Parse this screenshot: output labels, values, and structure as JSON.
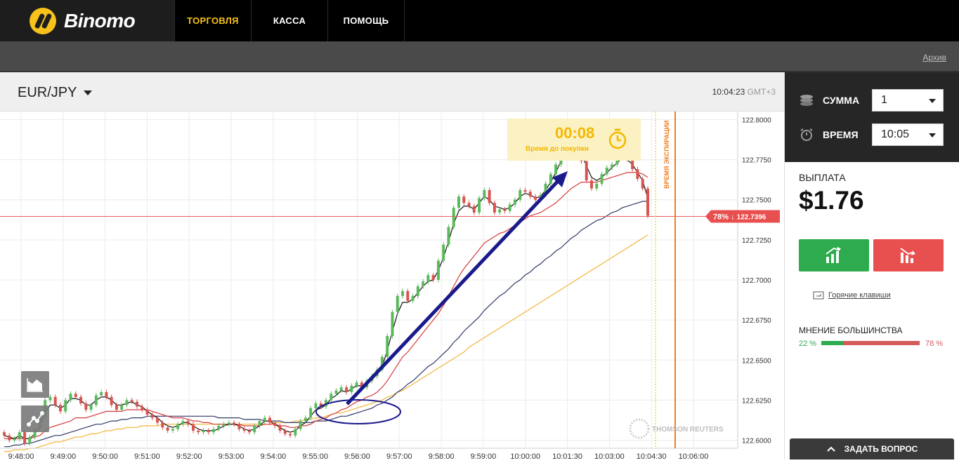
{
  "brand": {
    "name": "Binomo"
  },
  "nav": {
    "items": [
      {
        "label": "ТОРГОВЛЯ",
        "active": true
      },
      {
        "label": "КАССА"
      },
      {
        "label": "ПОМОЩЬ"
      }
    ]
  },
  "subbar": {
    "archive": "Архив"
  },
  "chart_header": {
    "pair": "EUR/JPY",
    "time": "10:04:23",
    "tz": "GMT+3"
  },
  "timer": {
    "value": "00:08",
    "label": "Время до покупки"
  },
  "expiry_label": "ВРЕМЯ ЭКСПИРАЦИИ",
  "price_tag": {
    "pct": "78%",
    "arrow": "↓",
    "price": "122.7396"
  },
  "watermark": "THOMSON REUTERS",
  "panel": {
    "amount_label": "СУММА",
    "amount_value": "1",
    "time_label": "ВРЕМЯ",
    "time_value": "10:05",
    "payout_label": "ВЫПЛАТА",
    "payout_value": "$1.76",
    "hotkeys": "Горячие клавиши",
    "majority_label": "МНЕНИЕ БОЛЬШИНСТВА",
    "majority_up": "22 %",
    "majority_down": "78 %"
  },
  "ask_button": "ЗАДАТЬ ВОПРОС",
  "colors": {
    "accent": "#f7c21b",
    "up": "#2dab4e",
    "down": "#e84f4f",
    "ema_red": "#d63a3a",
    "ema_navy": "#2f3a66",
    "ema_orange": "#f2b437",
    "expiry": "#f07d1e"
  },
  "chart_data": {
    "type": "candlestick",
    "y_ticks": [
      "122.8000",
      "122.7750",
      "122.7500",
      "122.7250",
      "122.7000",
      "122.6750",
      "122.6500",
      "122.6250",
      "122.6000"
    ],
    "x_ticks": [
      "9:48:00",
      "9:49:00",
      "9:50:00",
      "9:51:00",
      "9:52:00",
      "9:53:00",
      "9:54:00",
      "9:55:00",
      "9:56:00",
      "9:57:00",
      "9:58:00",
      "9:59:00",
      "10:00:00",
      "10:01:30",
      "10:03:00",
      "10:04:30",
      "10:06:00"
    ],
    "ylim": [
      122.595,
      122.805
    ],
    "current_price": 122.7396,
    "close": [
      122.603,
      122.6,
      122.601,
      122.605,
      122.598,
      122.602,
      122.607,
      122.615,
      122.625,
      122.627,
      122.622,
      122.618,
      122.625,
      122.629,
      122.627,
      122.623,
      122.619,
      122.622,
      122.628,
      122.63,
      122.627,
      122.622,
      122.619,
      122.622,
      122.625,
      122.624,
      122.621,
      122.619,
      122.616,
      122.614,
      122.611,
      122.608,
      122.606,
      122.607,
      122.61,
      122.612,
      122.61,
      122.606,
      122.605,
      122.606,
      122.605,
      122.607,
      122.609,
      122.61,
      122.611,
      122.61,
      122.607,
      122.606,
      122.605,
      122.609,
      122.612,
      122.614,
      122.611,
      122.609,
      122.606,
      122.604,
      122.603,
      122.607,
      122.612,
      122.614,
      122.62,
      122.623,
      122.621,
      122.625,
      122.629,
      122.631,
      122.633,
      122.63,
      122.634,
      122.636,
      122.633,
      122.637,
      122.64,
      122.644,
      122.652,
      122.665,
      122.68,
      122.69,
      122.693,
      122.687,
      122.69,
      122.696,
      122.699,
      122.703,
      122.7,
      122.712,
      122.722,
      122.733,
      122.745,
      122.752,
      122.748,
      122.746,
      122.742,
      122.751,
      122.756,
      122.748,
      122.742,
      122.744,
      122.743,
      122.747,
      122.75,
      122.756,
      122.755,
      122.752,
      122.75,
      122.753,
      122.76,
      122.766,
      122.772,
      122.781,
      122.786,
      122.788,
      122.785,
      122.774,
      122.762,
      122.757,
      122.76,
      122.766,
      122.77,
      122.772,
      122.776,
      122.778,
      122.775,
      122.769,
      122.763,
      122.757,
      122.74
    ],
    "ema_black": [
      122.603,
      122.602,
      122.601,
      122.603,
      122.601,
      122.601,
      122.604,
      122.609,
      122.617,
      122.622,
      122.622,
      122.62,
      122.622,
      122.626,
      122.626,
      122.625,
      122.622,
      122.622,
      122.625,
      122.627,
      122.627,
      122.625,
      122.622,
      122.622,
      122.623,
      122.624,
      122.622,
      122.621,
      122.618,
      122.616,
      122.614,
      122.611,
      122.609,
      122.608,
      122.609,
      122.611,
      122.611,
      122.609,
      122.607,
      122.606,
      122.606,
      122.606,
      122.607,
      122.609,
      122.61,
      122.61,
      122.609,
      122.607,
      122.606,
      122.607,
      122.609,
      122.612,
      122.612,
      122.61,
      122.608,
      122.606,
      122.605,
      122.606,
      122.609,
      122.611,
      122.615,
      122.619,
      122.62,
      122.622,
      122.626,
      122.628,
      122.631,
      122.63,
      122.632,
      122.634,
      122.634,
      122.635,
      122.638,
      122.641,
      122.646,
      122.656,
      122.668,
      122.679,
      122.686,
      122.686,
      122.688,
      122.692,
      122.696,
      122.699,
      122.7,
      122.706,
      122.714,
      122.724,
      122.735,
      122.743,
      122.746,
      122.746,
      122.744,
      122.748,
      122.752,
      122.75,
      122.746,
      122.745,
      122.744,
      122.745,
      122.748,
      122.752,
      122.754,
      122.753,
      122.751,
      122.752,
      122.756,
      122.761,
      122.767,
      122.774,
      122.78,
      122.784,
      122.785,
      122.779,
      122.771,
      122.764,
      122.762,
      122.764,
      122.767,
      122.77,
      122.773,
      122.776,
      122.775,
      122.772,
      122.767,
      122.762,
      122.751
    ],
    "ema_red": [
      122.601,
      122.601,
      122.601,
      122.601,
      122.601,
      122.601,
      122.602,
      122.603,
      122.606,
      122.608,
      122.609,
      122.61,
      122.611,
      122.612,
      122.614,
      122.614,
      122.614,
      122.615,
      122.616,
      122.617,
      122.618,
      122.618,
      122.618,
      122.618,
      122.619,
      122.619,
      122.619,
      122.619,
      122.619,
      122.618,
      122.617,
      122.616,
      122.615,
      122.614,
      122.614,
      122.614,
      122.613,
      122.612,
      122.612,
      122.611,
      122.611,
      122.61,
      122.61,
      122.61,
      122.61,
      122.61,
      122.61,
      122.609,
      122.609,
      122.609,
      122.609,
      122.61,
      122.61,
      122.61,
      122.609,
      122.609,
      122.608,
      122.608,
      122.609,
      122.609,
      122.61,
      122.612,
      122.613,
      122.614,
      122.616,
      122.617,
      122.619,
      122.62,
      122.622,
      122.624,
      122.625,
      122.627,
      122.628,
      122.63,
      122.633,
      122.637,
      122.642,
      122.647,
      122.652,
      122.655,
      122.659,
      122.663,
      122.667,
      122.671,
      122.675,
      122.679,
      122.684,
      122.69,
      122.696,
      122.702,
      122.707,
      122.711,
      122.715,
      122.719,
      122.723,
      122.725,
      122.727,
      122.729,
      122.73,
      122.732,
      122.734,
      122.736,
      122.738,
      122.74,
      122.741,
      122.742,
      122.744,
      122.746,
      122.748,
      122.751,
      122.754,
      122.757,
      122.759,
      122.761,
      122.761,
      122.761,
      122.761,
      122.762,
      122.763,
      122.764,
      122.765,
      122.766,
      122.767,
      122.767,
      122.767,
      122.766,
      122.764
    ],
    "ema_navy": [
      122.596,
      122.596,
      122.597,
      122.597,
      122.598,
      122.598,
      122.599,
      122.6,
      122.601,
      122.602,
      122.603,
      122.603,
      122.604,
      122.605,
      122.606,
      122.607,
      122.608,
      122.609,
      122.61,
      122.61,
      122.611,
      122.612,
      122.612,
      122.613,
      122.613,
      122.614,
      122.614,
      122.614,
      122.615,
      122.615,
      122.615,
      122.615,
      122.615,
      122.615,
      122.615,
      122.615,
      122.615,
      122.615,
      122.615,
      122.615,
      122.615,
      122.615,
      122.614,
      122.614,
      122.614,
      122.614,
      122.614,
      122.613,
      122.613,
      122.613,
      122.613,
      122.612,
      122.612,
      122.612,
      122.612,
      122.611,
      122.611,
      122.611,
      122.611,
      122.611,
      122.611,
      122.612,
      122.612,
      122.612,
      122.613,
      122.614,
      122.615,
      122.615,
      122.616,
      122.617,
      122.618,
      122.619,
      122.62,
      122.622,
      122.623,
      122.625,
      122.627,
      122.63,
      122.632,
      122.635,
      122.637,
      122.64,
      122.643,
      122.646,
      122.648,
      122.651,
      122.654,
      122.657,
      122.661,
      122.664,
      122.668,
      122.671,
      122.674,
      122.677,
      122.681,
      122.684,
      122.687,
      122.69,
      122.692,
      122.695,
      122.698,
      122.7,
      122.703,
      122.705,
      122.708,
      122.71,
      122.713,
      122.715,
      122.718,
      122.72,
      122.723,
      122.726,
      122.728,
      122.731,
      122.733,
      122.735,
      122.737,
      122.738,
      122.74,
      122.742,
      122.743,
      122.745,
      122.746,
      122.747,
      122.748,
      122.749,
      122.749
    ],
    "ema_orange": [
      122.593,
      122.593,
      122.594,
      122.594,
      122.594,
      122.595,
      122.595,
      122.596,
      122.597,
      122.598,
      122.599,
      122.599,
      122.6,
      122.601,
      122.602,
      122.602,
      122.603,
      122.604,
      122.604,
      122.605,
      122.606,
      122.606,
      122.607,
      122.607,
      122.608,
      122.608,
      122.608,
      122.609,
      122.609,
      122.609,
      122.609,
      122.61,
      122.61,
      122.61,
      122.61,
      122.61,
      122.61,
      122.61,
      122.61,
      122.61,
      122.61,
      122.61,
      122.61,
      122.61,
      122.61,
      122.61,
      122.61,
      122.61,
      122.61,
      122.61,
      122.61,
      122.61,
      122.61,
      122.611,
      122.611,
      122.611,
      122.611,
      122.612,
      122.612,
      122.613,
      122.613,
      122.614,
      122.614,
      122.615,
      122.616,
      122.617,
      122.617,
      122.618,
      122.619,
      122.62,
      122.621,
      122.622,
      122.623,
      122.624,
      122.625,
      122.627,
      122.628,
      122.63,
      122.631,
      122.633,
      122.635,
      122.637,
      122.639,
      122.641,
      122.643,
      122.645,
      122.647,
      122.649,
      122.651,
      122.653,
      122.655,
      122.658,
      122.66,
      122.662,
      122.664,
      122.666,
      122.668,
      122.67,
      122.672,
      122.674,
      122.676,
      122.678,
      122.68,
      122.682,
      122.684,
      122.686,
      122.688,
      122.69,
      122.692,
      122.694,
      122.696,
      122.698,
      122.7,
      122.702,
      122.704,
      122.706,
      122.708,
      122.71,
      122.712,
      122.714,
      122.716,
      122.718,
      122.72,
      122.722,
      122.724,
      122.726,
      122.728
    ]
  }
}
